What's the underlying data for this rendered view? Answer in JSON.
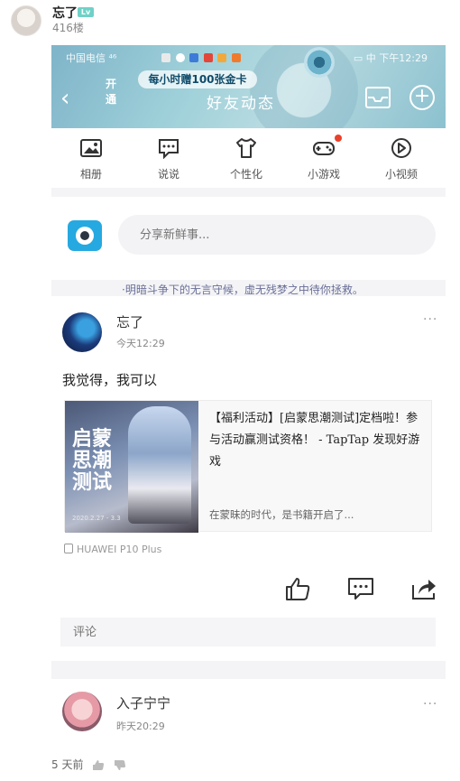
{
  "post": {
    "username": "忘了",
    "level": "Lv",
    "floor": "416楼",
    "time_ago": "5 天前"
  },
  "screenshot": {
    "status_bar": {
      "carrier": "中国电信 ⁴⁶",
      "right": "▭ 中 下午12:29"
    },
    "promo": {
      "open_label": "开通",
      "text": "每小时赠100张金卡"
    },
    "header": {
      "back": "‹",
      "title": "好友动态",
      "add": "+"
    },
    "nav": [
      {
        "label": "相册",
        "icon": "photo-icon"
      },
      {
        "label": "说说",
        "icon": "speech-bubble-icon"
      },
      {
        "label": "个性化",
        "icon": "tshirt-icon"
      },
      {
        "label": "小游戏",
        "icon": "gamepad-icon",
        "badge": true
      },
      {
        "label": "小视频",
        "icon": "play-circle-icon"
      }
    ],
    "share": {
      "placeholder": "分享新鲜事..."
    },
    "signature": "·明暗斗争下的无言守候，虚无残梦之中待你拯救。",
    "feed": [
      {
        "name": "忘了",
        "time": "今天12:29",
        "text": "我觉得，我可以",
        "link": {
          "title": "【福利活动】[启蒙思潮测试]定档啦！参与活动赢测试资格！ - TapTap 发现好游戏",
          "description": "在蒙昧的时代，是书籍开启了...",
          "thumb_title": "启蒙思潮测试",
          "thumb_date": "2020.2.27 - 3.3"
        },
        "device": "HUAWEI P10 Plus",
        "comment_placeholder": "评论"
      },
      {
        "name": "入子宁宁",
        "time": "昨天20:29"
      }
    ],
    "more": "···"
  },
  "colors": {
    "accent": "#25a9e0",
    "badge": "#e8412b",
    "banner": "#8cc1cf"
  }
}
